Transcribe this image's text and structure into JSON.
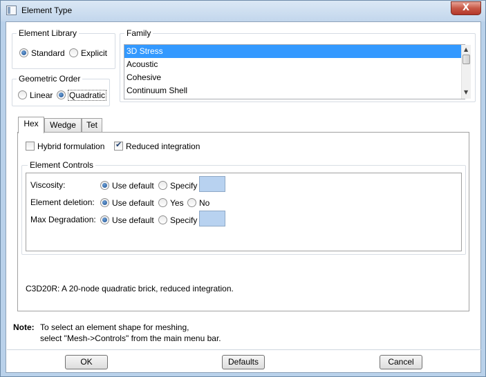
{
  "window": {
    "title": "Element Type",
    "close_label": "X"
  },
  "element_library": {
    "title": "Element Library",
    "options": [
      "Standard",
      "Explicit"
    ],
    "selected": "Standard"
  },
  "family": {
    "title": "Family",
    "items": [
      "3D Stress",
      "Acoustic",
      "Cohesive",
      "Continuum Shell"
    ],
    "selected": "3D Stress"
  },
  "geometric_order": {
    "title": "Geometric Order",
    "options": [
      "Linear",
      "Quadratic"
    ],
    "selected": "Quadratic"
  },
  "tabs": [
    {
      "label": "Hex",
      "active": true
    },
    {
      "label": "Wedge",
      "active": false
    },
    {
      "label": "Tet",
      "active": false
    }
  ],
  "hex": {
    "hybrid_label": "Hybrid formulation",
    "hybrid_checked": false,
    "reduced_label": "Reduced integration",
    "reduced_checked": true,
    "controls_title": "Element Controls",
    "viscosity": {
      "label": "Viscosity:",
      "use_default": "Use default",
      "specify": "Specify"
    },
    "deletion": {
      "label": "Element deletion:",
      "use_default": "Use default",
      "yes": "Yes",
      "no": "No"
    },
    "max_degradation": {
      "label": "Max Degradation:",
      "use_default": "Use default",
      "specify": "Specify"
    },
    "description": "C3D20R:  A 20-node quadratic brick, reduced integration."
  },
  "note": {
    "label": "Note:",
    "line1": "To select an element shape for meshing,",
    "line2": "select \"Mesh->Controls\" from the main menu bar."
  },
  "buttons": {
    "ok": "OK",
    "defaults": "Defaults",
    "cancel": "Cancel"
  },
  "colors": {
    "selection": "#3399ff",
    "specify_box": "#b8d2f0",
    "title_bar": "#c2d6ec",
    "close": "#c75846"
  }
}
